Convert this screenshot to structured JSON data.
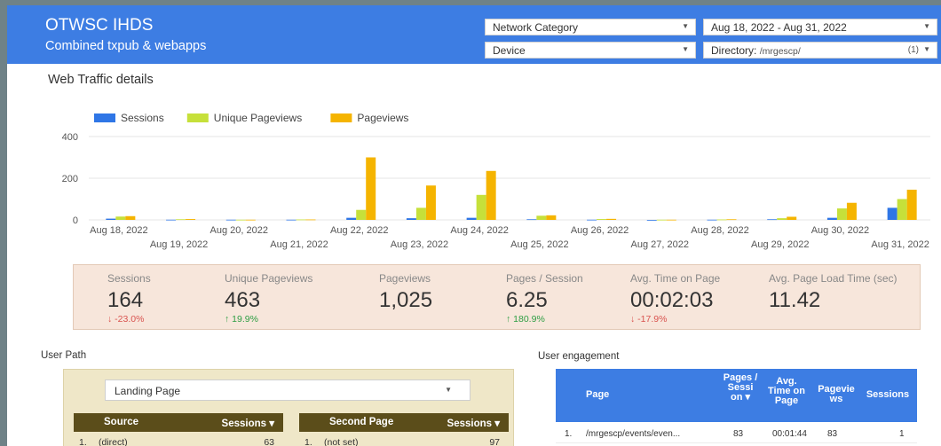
{
  "header": {
    "title": "OTWSC IHDS",
    "subtitle": "Combined txpub & webapps",
    "filters": {
      "network_category": "Network Category",
      "date_range": "Aug 18, 2022 - Aug 31, 2022",
      "device": "Device",
      "directory_label": "Directory:",
      "directory_value": "/mrgescp/",
      "directory_count": "(1)"
    }
  },
  "section_title": "Web Traffic details",
  "chart_data": {
    "type": "bar",
    "categories": [
      "Aug 18, 2022",
      "Aug 19, 2022",
      "Aug 20, 2022",
      "Aug 21, 2022",
      "Aug 22, 2022",
      "Aug 23, 2022",
      "Aug 24, 2022",
      "Aug 25, 2022",
      "Aug 26, 2022",
      "Aug 27, 2022",
      "Aug 28, 2022",
      "Aug 29, 2022",
      "Aug 30, 2022",
      "Aug 31, 2022"
    ],
    "series": [
      {
        "name": "Sessions",
        "color": "#2f76e6",
        "values": [
          6,
          1,
          1,
          1,
          10,
          8,
          10,
          3,
          1,
          0,
          1,
          3,
          10,
          58
        ]
      },
      {
        "name": "Unique Pageviews",
        "color": "#c6e03a",
        "values": [
          16,
          3,
          1,
          2,
          48,
          58,
          120,
          20,
          4,
          1,
          2,
          8,
          55,
          100
        ]
      },
      {
        "name": "Pageviews",
        "color": "#f5b400",
        "values": [
          18,
          4,
          1,
          2,
          300,
          165,
          235,
          22,
          5,
          1,
          3,
          15,
          82,
          145
        ]
      }
    ],
    "ylim": [
      0,
      400
    ],
    "yticks": [
      "0",
      "200",
      "400"
    ],
    "legend": "top-left",
    "grid": true
  },
  "kpis": [
    {
      "label": "Sessions",
      "value": "164",
      "change": "↓ -23.0%",
      "trend": "down"
    },
    {
      "label": "Unique Pageviews",
      "value": "463",
      "change": "↑ 19.9%",
      "trend": "up"
    },
    {
      "label": "Pageviews",
      "value": "1,025",
      "change": "",
      "trend": ""
    },
    {
      "label": "Pages / Session",
      "value": "6.25",
      "change": "↑ 180.9%",
      "trend": "up"
    },
    {
      "label": "Avg. Time on Page",
      "value": "00:02:03",
      "change": "↓ -17.9%",
      "trend": "down"
    },
    {
      "label": "Avg. Page Load Time (sec)",
      "value": "11.42",
      "change": "",
      "trend": ""
    }
  ],
  "user_path": {
    "label": "User Path",
    "landing_select": "Landing Page",
    "source_table": {
      "col1": "Source",
      "col2": "Sessions ▾",
      "row_num": "1.",
      "row_source": "(direct)",
      "row_sessions": "63"
    },
    "second_table": {
      "col1": "Second Page",
      "col2": "Sessions ▾",
      "row_num": "1.",
      "row_page": "(not set)",
      "row_sessions": "97"
    }
  },
  "engagement": {
    "label": "User engagement",
    "headers": {
      "page": "Page",
      "pages_session": "Pages / Sessi on ▾",
      "avg_time": "Avg. Time on Page",
      "pageviews": "Pagevie ws",
      "sessions": "Sessions"
    },
    "row": {
      "num": "1.",
      "page": "/mrgescp/events/even...",
      "pages_session": "83",
      "avg_time": "00:01:44",
      "pageviews": "83",
      "sessions": "1"
    }
  }
}
